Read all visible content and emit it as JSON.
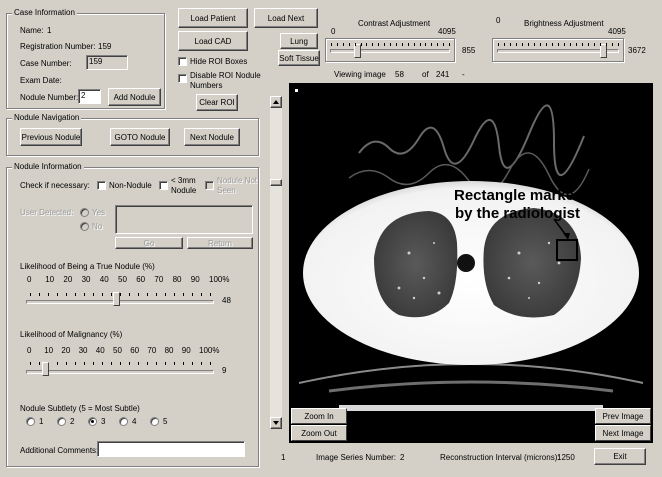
{
  "case_info": {
    "legend": "Case Information",
    "name_label": "Name:",
    "name_value": "1",
    "reg_label": "Registration Number:",
    "reg_value": "159",
    "case_label": "Case Number:",
    "case_value": "159",
    "exam_label": "Exam Date:",
    "nodule_label": "Nodule Number:",
    "nodule_value": "2",
    "add_nodule": "Add Nodule"
  },
  "top_buttons": {
    "load_patient": "Load Patient",
    "load_next": "Load Next",
    "load_cad": "Load CAD",
    "lung": "Lung",
    "soft_tissue": "Soft Tissue",
    "hide_roi": "Hide ROI Boxes",
    "disable_roi_1": "Disable ROI Nodule",
    "disable_roi_2": "Numbers",
    "clear_roi": "Clear ROI"
  },
  "contrast": {
    "title": "Contrast Adjustment",
    "min": "0",
    "max": "4095",
    "value": "855",
    "level": 0.209
  },
  "brightness": {
    "title": "Brightness Adjustment",
    "min": "0",
    "max": "4095",
    "value": "3672",
    "level": 0.897
  },
  "viewing": {
    "label": "Viewing image",
    "current": "58",
    "of": "of",
    "total": "241",
    "dash": "-"
  },
  "nodule_nav": {
    "legend": "Nodule Navigation",
    "previous": "Previous Nodule",
    "goto": "GOTO Nodule",
    "next": "Next Nodule"
  },
  "nodule_info": {
    "legend": "Nodule Information",
    "check_label": "Check if necessary:",
    "non_nodule": "Non-Nodule",
    "lt3mm_1": "< 3mm",
    "lt3mm_2": "Nodule",
    "not_seen_1": "Nodule Not",
    "not_seen_2": "Seen",
    "user_detected": "User Detected:",
    "yes": "Yes",
    "no": "No",
    "go": "Go",
    "return": "Return"
  },
  "likelihood_true": {
    "title": "Likelihood of Being a True Nodule (%)",
    "ticks": [
      "0",
      "10",
      "20",
      "30",
      "40",
      "50",
      "60",
      "70",
      "80",
      "90",
      "100%"
    ],
    "value": "48",
    "level": 0.48
  },
  "likelihood_malig": {
    "title": "Likelihood of Malignancy (%)",
    "ticks": [
      "0",
      "10",
      "20",
      "30",
      "40",
      "50",
      "60",
      "70",
      "80",
      "90",
      "100%"
    ],
    "value": "9",
    "level": 0.09
  },
  "subtlety": {
    "title": "Nodule Subtlety (5 = Most Subtle)",
    "options": [
      "1",
      "2",
      "3",
      "4",
      "5"
    ],
    "selected": "3"
  },
  "comments": {
    "label": "Additional Comments:",
    "value": ""
  },
  "image": {
    "annotation_line1": "Rectangle marked",
    "annotation_line2": "by the radiologist",
    "zoom_in": "Zoom In",
    "zoom_out": "Zoom Out",
    "prev_image": "Prev Image",
    "next_image": "Next Image"
  },
  "status": {
    "left_value": "1",
    "series_label": "Image Series Number:",
    "series_value": "2",
    "recon_label": "Reconstruction Interval (microns):",
    "recon_value": "1250",
    "exit": "Exit"
  }
}
